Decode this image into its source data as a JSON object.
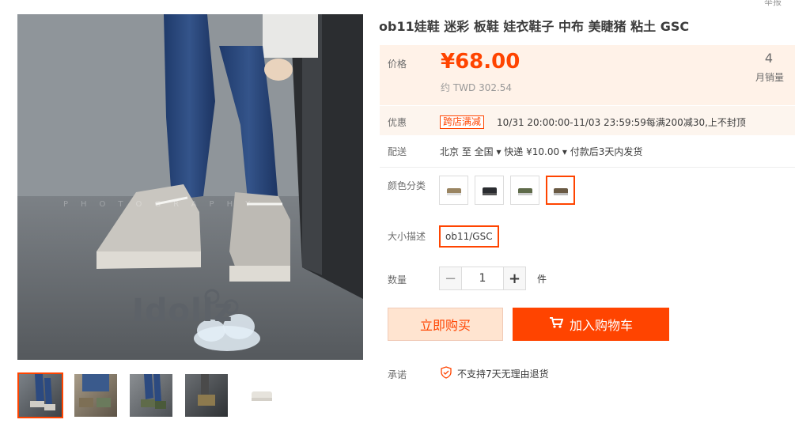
{
  "corner": {
    "text": "举报"
  },
  "product": {
    "title": "ob11娃鞋 迷彩 板鞋 娃衣鞋子 中布 美睫猪 粘土 GSC"
  },
  "main_image": {
    "watermark": "PHOTOGRAPHY",
    "logo": "Idollz"
  },
  "thumbnails": [
    {
      "name": "thumb-1",
      "active": true
    },
    {
      "name": "thumb-2",
      "active": false
    },
    {
      "name": "thumb-3",
      "active": false
    },
    {
      "name": "thumb-4",
      "active": false
    },
    {
      "name": "thumb-5",
      "active": false
    }
  ],
  "price": {
    "label": "价格",
    "value": "¥68.00",
    "converted": "约 TWD 302.54",
    "sales_count": "4",
    "sales_label": "月销量"
  },
  "promotion": {
    "label": "优惠",
    "tag": "跨店满减",
    "text": "10/31 20:00:00-11/03 23:59:59每满200减30,上不封顶"
  },
  "shipping": {
    "label": "配送",
    "text": "北京 至  全国 ▾   快递 ¥10.00 ▾   付款后3天内发货"
  },
  "color": {
    "label": "颜色分类",
    "selected_index": 3
  },
  "size": {
    "label": "大小描述",
    "option": "ob11/GSC"
  },
  "quantity": {
    "label": "数量",
    "value": "1",
    "unit": "件",
    "minus": "−",
    "plus": "+"
  },
  "actions": {
    "buy_now": "立即购买",
    "add_to_cart": "加入购物车"
  },
  "promise": {
    "label": "承诺",
    "text": "不支持7天无理由退货"
  },
  "colors": {
    "accent": "#ff4400",
    "price_bg": "#fff2e8"
  }
}
